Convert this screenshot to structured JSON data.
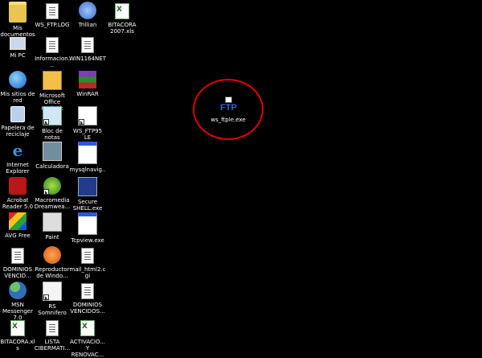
{
  "desktop": {
    "icons": [
      {
        "id": "mis-documentos",
        "label": "Mis documentos",
        "icon": "folder-icon"
      },
      {
        "id": "ws-ftp-log",
        "label": "WS_FTP.LOG",
        "icon": "text-document-icon"
      },
      {
        "id": "trillian",
        "label": "Trillian",
        "icon": "trillian-icon"
      },
      {
        "id": "bitacora-2007",
        "label": "BITACORA 2007.xls",
        "icon": "excel-file-icon"
      },
      {
        "id": "mi-pc",
        "label": "Mi PC",
        "icon": "computer-icon"
      },
      {
        "id": "informacion",
        "label": "Informacion...",
        "icon": "text-document-icon"
      },
      {
        "id": "win1164net",
        "label": "WIN1164NET",
        "icon": "text-document-icon"
      },
      {
        "id": "mis-sitios-de-red",
        "label": "Mis sitios de red",
        "icon": "network-icon"
      },
      {
        "id": "outlook",
        "label": "Microsoft Office Outlook",
        "icon": "outlook-icon"
      },
      {
        "id": "winrar",
        "label": "WinRAR",
        "icon": "winrar-icon"
      },
      {
        "id": "papelera",
        "label": "Papelera de reciclaje",
        "icon": "recycle-bin-icon"
      },
      {
        "id": "bloc-de-notas",
        "label": "Bloc de notas",
        "icon": "notepad-icon"
      },
      {
        "id": "ws-ftp95",
        "label": "WS_FTP95 LE",
        "icon": "ftp-shortcut-icon"
      },
      {
        "id": "ie",
        "label": "Internet Explorer",
        "icon": "internet-explorer-icon"
      },
      {
        "id": "calculadora",
        "label": "Calculadora",
        "icon": "calculator-icon"
      },
      {
        "id": "mysqlnavig",
        "label": "mysqlnavig...",
        "icon": "window-icon"
      },
      {
        "id": "acrobat",
        "label": "Acrobat Reader 5.0",
        "icon": "acrobat-icon"
      },
      {
        "id": "dreamweaver",
        "label": "Macromedia Dreamwea...",
        "icon": "dreamweaver-icon"
      },
      {
        "id": "secure-shell",
        "label": "Secure SHELL.exe",
        "icon": "ssh-icon"
      },
      {
        "id": "avg",
        "label": "AVG Free",
        "icon": "avg-icon"
      },
      {
        "id": "paint",
        "label": "Paint",
        "icon": "paint-icon"
      },
      {
        "id": "tcpview",
        "label": "Tcpview.exe",
        "icon": "window-icon"
      },
      {
        "id": "dominios-1",
        "label": "DOMINIOS VENCID...",
        "icon": "text-document-icon"
      },
      {
        "id": "reproductor",
        "label": "Reproductor de Windo...",
        "icon": "media-player-icon"
      },
      {
        "id": "mail-html2",
        "label": "mail_html2.cgi",
        "icon": "cgi-file-icon"
      },
      {
        "id": "msn",
        "label": "MSN Messenger 7.0",
        "icon": "msn-icon"
      },
      {
        "id": "rs-somnifero",
        "label": "RS Somnifero",
        "icon": "shortcut-icon"
      },
      {
        "id": "dominios-2",
        "label": "DOMINIOS VENCIDOS...",
        "icon": "text-document-icon"
      },
      {
        "id": "bitacora",
        "label": "BITACORA.xls",
        "icon": "excel-file-icon"
      },
      {
        "id": "lista-cibermati",
        "label": "LISTA CIBERMATI...",
        "icon": "text-document-icon"
      },
      {
        "id": "activacio",
        "label": "ACTIVACIO... Y RENOVAC...",
        "icon": "excel-file-icon"
      }
    ],
    "highlighted_icon": {
      "label": "ws_ftple.exe",
      "icon": "ws-ftp-icon",
      "glyph_text": "FTP"
    },
    "highlight_color": "#e00000"
  }
}
